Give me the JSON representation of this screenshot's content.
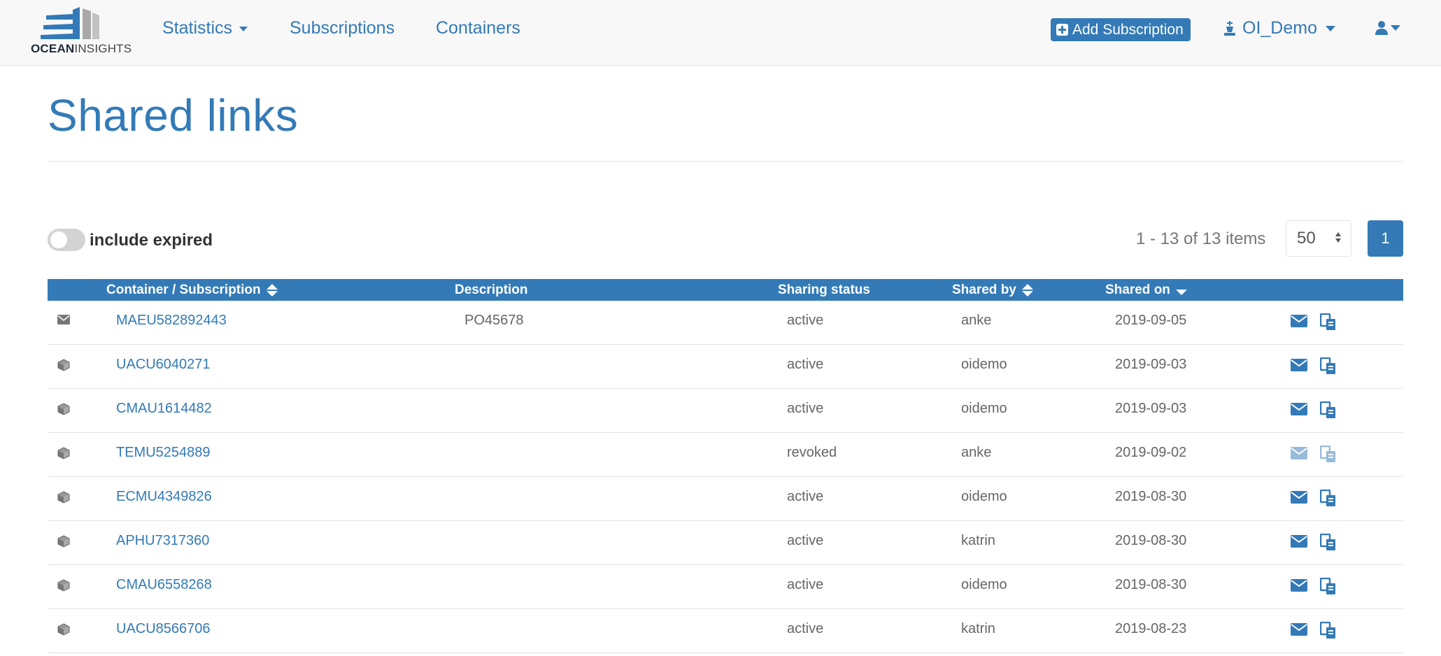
{
  "app": {
    "logo_bold": "OCEAN",
    "logo_light": "INSIGHTS"
  },
  "nav": {
    "statistics": "Statistics",
    "subscriptions": "Subscriptions",
    "containers": "Containers",
    "add_subscription": "Add Subscription",
    "organization": "OI_Demo"
  },
  "page": {
    "title": "Shared links",
    "include_expired_label": "include expired",
    "include_expired": false
  },
  "pagination": {
    "info": "1 - 13 of 13 items",
    "page_size": "50",
    "current_page": "1"
  },
  "table": {
    "headers": {
      "container_subscription": "Container / Subscription",
      "description": "Description",
      "sharing_status": "Sharing status",
      "shared_by": "Shared by",
      "shared_on": "Shared on"
    },
    "rows": [
      {
        "type": "subscription",
        "type_icon": "envelope-icon",
        "id": "MAEU582892443",
        "description": "PO45678",
        "status": "active",
        "shared_by": "anke",
        "shared_on": "2019-09-05"
      },
      {
        "type": "container",
        "type_icon": "cube-icon",
        "id": "UACU6040271",
        "description": "",
        "status": "active",
        "shared_by": "oidemo",
        "shared_on": "2019-09-03"
      },
      {
        "type": "container",
        "type_icon": "cube-icon",
        "id": "CMAU1614482",
        "description": "",
        "status": "active",
        "shared_by": "oidemo",
        "shared_on": "2019-09-03"
      },
      {
        "type": "container",
        "type_icon": "cube-icon",
        "id": "TEMU5254889",
        "description": "",
        "status": "revoked",
        "shared_by": "anke",
        "shared_on": "2019-09-02"
      },
      {
        "type": "container",
        "type_icon": "cube-icon",
        "id": "ECMU4349826",
        "description": "",
        "status": "active",
        "shared_by": "oidemo",
        "shared_on": "2019-08-30"
      },
      {
        "type": "container",
        "type_icon": "cube-icon",
        "id": "APHU7317360",
        "description": "",
        "status": "active",
        "shared_by": "katrin",
        "shared_on": "2019-08-30"
      },
      {
        "type": "container",
        "type_icon": "cube-icon",
        "id": "CMAU6558268",
        "description": "",
        "status": "active",
        "shared_by": "oidemo",
        "shared_on": "2019-08-30"
      },
      {
        "type": "container",
        "type_icon": "cube-icon",
        "id": "UACU8566706",
        "description": "",
        "status": "active",
        "shared_by": "katrin",
        "shared_on": "2019-08-23"
      }
    ]
  },
  "colors": {
    "primary": "#337ab7",
    "navbar_bg": "#f8f8f8",
    "muted_text": "#666666",
    "toggle_off": "#d3d3d3"
  }
}
